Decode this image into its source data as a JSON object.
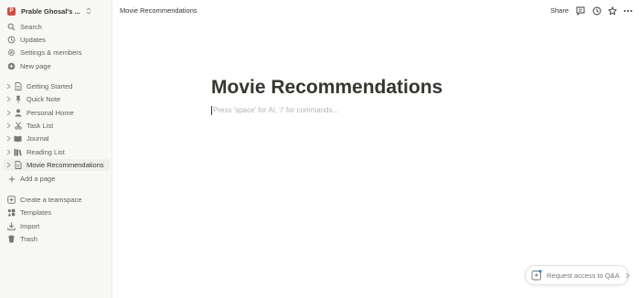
{
  "workspace": {
    "logo_letter": "P",
    "name": "Prable Ghosal's ..."
  },
  "sidebar": {
    "top_items": [
      {
        "label": "Search",
        "icon": "search-icon"
      },
      {
        "label": "Updates",
        "icon": "clock-icon"
      },
      {
        "label": "Settings & members",
        "icon": "gear-icon"
      },
      {
        "label": "New page",
        "icon": "plus-circle-icon"
      }
    ],
    "pages": [
      {
        "label": "Getting Started",
        "icon": "document-icon"
      },
      {
        "label": "Quick Note",
        "icon": "pin-icon"
      },
      {
        "label": "Personal Home",
        "icon": "person-icon"
      },
      {
        "label": "Task List",
        "icon": "scissors-icon"
      },
      {
        "label": "Journal",
        "icon": "book-icon"
      },
      {
        "label": "Reading List",
        "icon": "books-icon"
      },
      {
        "label": "Movie Recommendations",
        "icon": "document-icon",
        "active": true
      }
    ],
    "add_page": "Add a page",
    "bottom_items": [
      {
        "label": "Create a teamspace",
        "icon": "teamspace-icon"
      },
      {
        "label": "Templates",
        "icon": "templates-icon"
      },
      {
        "label": "Import",
        "icon": "import-icon"
      },
      {
        "label": "Trash",
        "icon": "trash-icon"
      }
    ]
  },
  "topbar": {
    "breadcrumb": "Movie Recommendations",
    "share_label": "Share"
  },
  "page": {
    "title": "Movie Recommendations",
    "placeholder": "Press 'space' for AI, '/' for commands..."
  },
  "qa_button": {
    "label": "Request access to Q&A"
  },
  "colors": {
    "sidebar_bg": "#f7f7f5",
    "logo": "#d44c47",
    "text": "#37352f",
    "muted": "#9b9a97",
    "ai_accent": "#2383e2"
  }
}
